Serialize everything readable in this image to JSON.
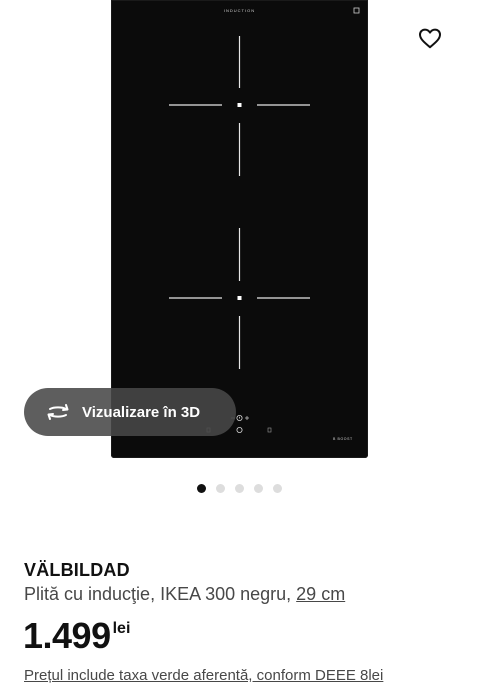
{
  "hero": {
    "favorite_icon": "heart-outline-icon",
    "hob": {
      "brand_text": "INDUCTION",
      "boost_text": "B BOOST"
    },
    "view3d": {
      "icon": "rotate-3d-icon",
      "label": "Vizualizare în 3D"
    },
    "carousel": {
      "total": 5,
      "active": 1
    }
  },
  "product": {
    "name": "VÄLBILDAD",
    "description": "Plită cu inducţie, IKEA 300 negru, ",
    "size": "29 cm",
    "price_amount": "1.499",
    "price_currency": "lei",
    "eco_note": "Prețul include taxa verde aferentă, conform DEEE 8lei"
  },
  "colors": {
    "text": "#111111",
    "muted": "#484848",
    "hob": "#0b0b0b",
    "pill": "#484848"
  }
}
